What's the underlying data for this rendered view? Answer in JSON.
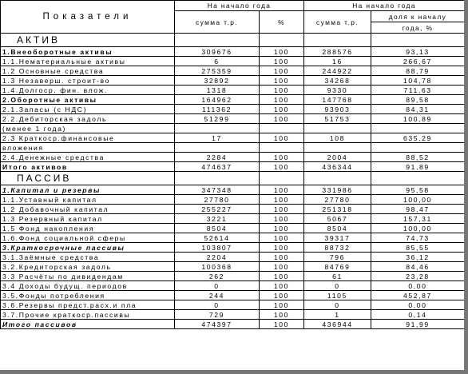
{
  "header": {
    "indicators": "Показатели",
    "start_of_year_1": "На начало года",
    "start_of_year_2": "На начало года",
    "sum_thousand": "сумма т.р.",
    "percent": "%",
    "sum_thousand_2": "сумма т.р.",
    "share_of_start_1": "доля к началу",
    "share_of_start_2": "года, %"
  },
  "sections": {
    "asset": "АКТИВ",
    "liability": "ПАССИВ"
  },
  "asset_rows": [
    {
      "label": "1.Внеоборотные активы",
      "v1": "309676",
      "v2": "100",
      "v3": "288576",
      "v4": "93,13",
      "style": "bold"
    },
    {
      "label": "1.1.Нематериальные активы",
      "v1": "6",
      "v2": "100",
      "v3": "16",
      "v4": "266,67",
      "style": ""
    },
    {
      "label": "1.2 Основные средства",
      "v1": "275359",
      "v2": "100",
      "v3": "244922",
      "v4": "88,79",
      "style": ""
    },
    {
      "label": "1.3 Незаверш. строит-во",
      "v1": "32892",
      "v2": "100",
      "v3": "34268",
      "v4": "104,78",
      "style": ""
    },
    {
      "label": "1.4.Долгоср. фин. влож.",
      "v1": "1318",
      "v2": "100",
      "v3": "9330",
      "v4": "711,63",
      "style": ""
    },
    {
      "label": "2.Оборотные активы",
      "v1": "164962",
      "v2": "100",
      "v3": "147768",
      "v4": "89,58",
      "style": "bold"
    },
    {
      "label": "2.1.Запасы (с НДС)",
      "v1": "111362",
      "v2": "100",
      "v3": "93903",
      "v4": "84,31",
      "style": ""
    },
    {
      "label": "2.2.Дебиторская задоль",
      "v1": "51299",
      "v2": "100",
      "v3": "51753",
      "v4": "100,89",
      "style": ""
    },
    {
      "label": "    (менее 1 года)",
      "v1": "",
      "v2": "",
      "v3": "",
      "v4": "",
      "style": ""
    },
    {
      "label": "2.3 Краткоср.финансовые",
      "v1": "17",
      "v2": "100",
      "v3": "108",
      "v4": "635,29",
      "style": ""
    },
    {
      "label": "    вложения",
      "v1": "",
      "v2": "",
      "v3": "",
      "v4": "",
      "style": ""
    },
    {
      "label": "2.4.Денежные средства",
      "v1": "2284",
      "v2": "100",
      "v3": "2004",
      "v4": "88,52",
      "style": ""
    },
    {
      "label": "Итого активов",
      "v1": "474637",
      "v2": "100",
      "v3": "436344",
      "v4": "91,89",
      "style": "bold"
    }
  ],
  "liability_rows": [
    {
      "label": "1.Капитал и резервы",
      "v1": "347348",
      "v2": "100",
      "v3": "331986",
      "v4": "95,58",
      "style": "bi"
    },
    {
      "label": "1.1.Уставный капитал",
      "v1": "27780",
      "v2": "100",
      "v3": "27780",
      "v4": "100,00",
      "style": ""
    },
    {
      "label": "1.2 Добавочный капитал",
      "v1": "255227",
      "v2": "100",
      "v3": "251318",
      "v4": "98,47",
      "style": ""
    },
    {
      "label": "1.3 Резервный капитал",
      "v1": "3221",
      "v2": "100",
      "v3": "5067",
      "v4": "157,31",
      "style": ""
    },
    {
      "label": "1.5 Фонд накопления",
      "v1": "8504",
      "v2": "100",
      "v3": "8504",
      "v4": "100,00",
      "style": ""
    },
    {
      "label": "1.6.Фонд социальной сферы",
      "v1": "52614",
      "v2": "100",
      "v3": "39317",
      "v4": "74,73",
      "style": ""
    },
    {
      "label": "3.Краткосрочные пассивы",
      "v1": "103807",
      "v2": "100",
      "v3": "88732",
      "v4": "85,55",
      "style": "bi"
    },
    {
      "label": "3.1.Заёмные средства",
      "v1": "2204",
      "v2": "100",
      "v3": "796",
      "v4": "36,12",
      "style": ""
    },
    {
      "label": "3.2.Кредиторская задоль",
      "v1": "100368",
      "v2": "100",
      "v3": "84769",
      "v4": "84,46",
      "style": ""
    },
    {
      "label": "3.3 Расчёты по дивидендам",
      "v1": "262",
      "v2": "100",
      "v3": "61",
      "v4": "23,28",
      "style": ""
    },
    {
      "label": "3.4 Доходы будущ. периодов",
      "v1": "0",
      "v2": "100",
      "v3": "0",
      "v4": "0,00",
      "style": ""
    },
    {
      "label": "3.5.Фонды потребления",
      "v1": "244",
      "v2": "100",
      "v3": "1105",
      "v4": "452,87",
      "style": ""
    },
    {
      "label": "3.6.Резервы предст.расх.и пла",
      "v1": "0",
      "v2": "100",
      "v3": "0",
      "v4": "0,00",
      "style": ""
    },
    {
      "label": "3.7.Прочие краткоср.пассивы",
      "v1": "729",
      "v2": "100",
      "v3": "1",
      "v4": "0,14",
      "style": ""
    },
    {
      "label": "Итого пассивов",
      "v1": "474397",
      "v2": "100",
      "v3": "436944",
      "v4": "91,99",
      "style": "bi"
    }
  ]
}
